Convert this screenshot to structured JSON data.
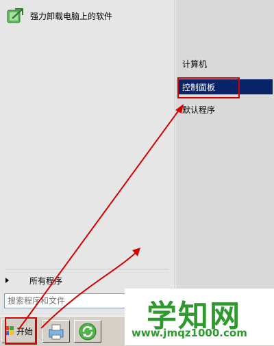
{
  "start_menu": {
    "pinned_items": [
      {
        "label": "强力卸载电脑上的软件",
        "icon": "uninstaller-app-icon"
      }
    ],
    "all_programs_label": "所有程序",
    "search": {
      "placeholder": "搜索程序和文件"
    },
    "right_items": [
      {
        "label": "计算机",
        "selected": false
      },
      {
        "label": "控制面板",
        "selected": true
      },
      {
        "label": "默认程序",
        "selected": false
      }
    ]
  },
  "taskbar": {
    "start_label": "开始",
    "buttons": [
      {
        "icon": "printer-icon"
      },
      {
        "icon": "refresh-globe-icon"
      }
    ]
  },
  "watermark": {
    "title": "学知网",
    "url": "www.jmqz1000.com"
  },
  "colors": {
    "selection": "#0a246a",
    "annotation_red": "#d40000",
    "watermark_green": "#2e9a2e"
  }
}
